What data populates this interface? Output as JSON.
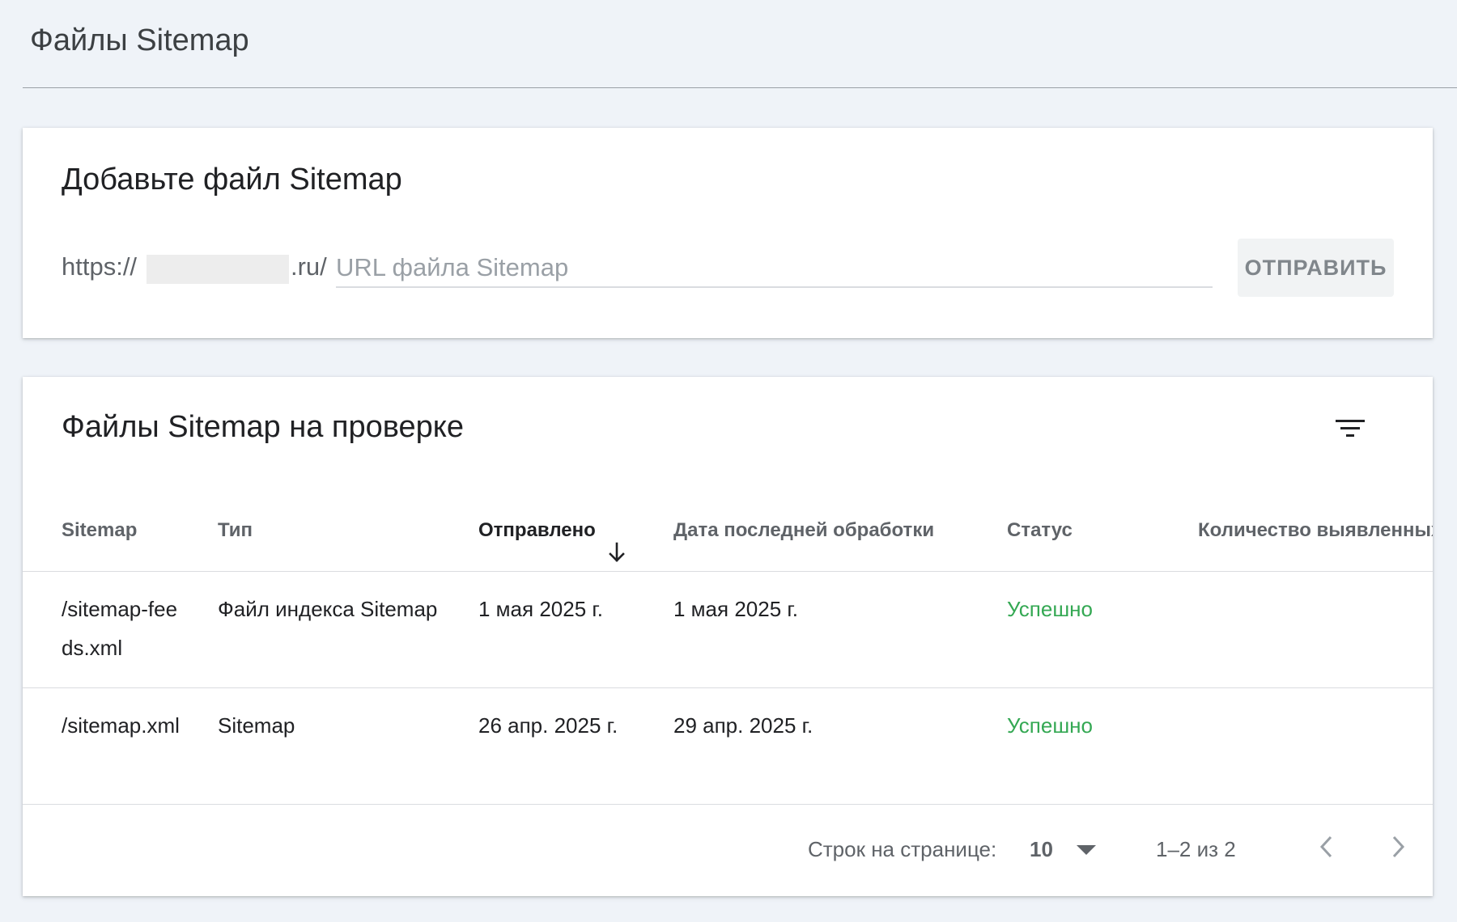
{
  "header": {
    "title": "Файлы Sitemap"
  },
  "add_card": {
    "title": "Добавьте файл Sitemap",
    "url_prefix": "https://",
    "url_suffix": ".ru/",
    "input_value": "",
    "input_placeholder": "URL файла Sitemap",
    "submit_label": "ОТПРАВИТЬ"
  },
  "list_card": {
    "title": "Файлы Sitemap на проверке",
    "filter_icon": "filter-list-icon",
    "columns": {
      "sitemap": "Sitemap",
      "type": "Тип",
      "sent": "Отправлено",
      "processed": "Дата последней обработки",
      "status": "Статус",
      "count": "Количество выявленных"
    },
    "sort_icon": "arrow-down-icon",
    "rows": [
      {
        "sitemap": "/sitemap-feeds.xml",
        "type": "Файл индекса Sitemap",
        "sent": "1 мая 2025 г.",
        "processed": "1 мая 2025 г.",
        "status": "Успешно",
        "count": ""
      },
      {
        "sitemap": "/sitemap.xml",
        "type": "Sitemap",
        "sent": "26 апр. 2025 г.",
        "processed": "29 апр. 2025 г.",
        "status": "Успешно",
        "count": ""
      }
    ],
    "footer": {
      "rows_per_page_label": "Строк на странице:",
      "rows_per_page_value": "10",
      "range": "1–2 из 2",
      "prev_icon": "chevron-left-icon",
      "next_icon": "chevron-right-icon"
    }
  },
  "colors": {
    "background": "#eff3f8",
    "status_success": "#34a853",
    "masked_domain": "#ededed"
  }
}
